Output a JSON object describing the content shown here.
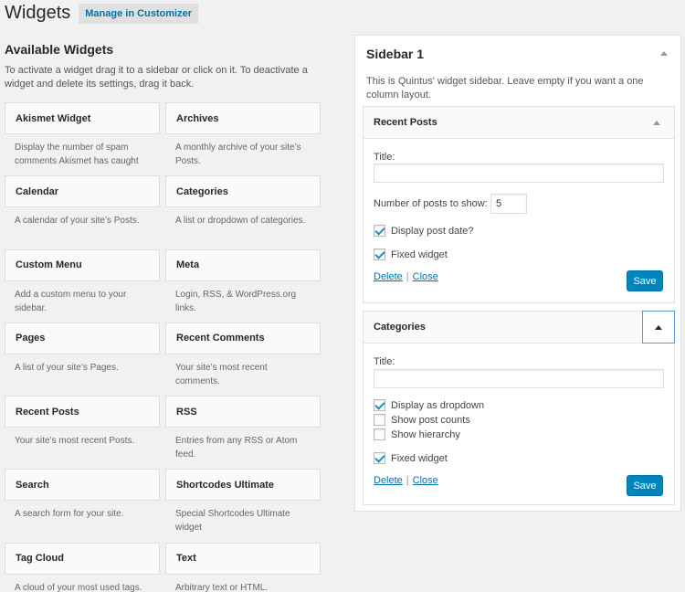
{
  "header": {
    "title": "Widgets",
    "customizer_button": "Manage in Customizer"
  },
  "available": {
    "title": "Available Widgets",
    "description": "To activate a widget drag it to a sidebar or click on it. To deactivate a widget and delete its settings, drag it back.",
    "widgets": [
      {
        "title": "Akismet Widget",
        "desc": "Display the number of spam comments Akismet has caught"
      },
      {
        "title": "Archives",
        "desc": "A monthly archive of your site’s Posts."
      },
      {
        "title": "Calendar",
        "desc": "A calendar of your site’s Posts."
      },
      {
        "title": "Categories",
        "desc": "A list or dropdown of categories."
      },
      {
        "title": "Custom Menu",
        "desc": "Add a custom menu to your sidebar."
      },
      {
        "title": "Meta",
        "desc": "Login, RSS, & WordPress.org links."
      },
      {
        "title": "Pages",
        "desc": "A list of your site’s Pages."
      },
      {
        "title": "Recent Comments",
        "desc": "Your site’s most recent comments."
      },
      {
        "title": "Recent Posts",
        "desc": "Your site’s most recent Posts."
      },
      {
        "title": "RSS",
        "desc": "Entries from any RSS or Atom feed."
      },
      {
        "title": "Search",
        "desc": "A search form for your site."
      },
      {
        "title": "Shortcodes Ultimate",
        "desc": "Special Shortcodes Ultimate widget"
      },
      {
        "title": "Tag Cloud",
        "desc": "A cloud of your most used tags."
      },
      {
        "title": "Text",
        "desc": "Arbitrary text or HTML."
      }
    ]
  },
  "sidebar": {
    "title": "Sidebar 1",
    "description": "This is Quintus' widget sidebar. Leave empty if you want a one column layout.",
    "recent_posts": {
      "title": "Recent Posts",
      "title_label": "Title:",
      "title_value": "",
      "number_label": "Number of posts to show:",
      "number_value": "5",
      "display_date_label": "Display post date?",
      "display_date_checked": true,
      "fixed_label": "Fixed widget",
      "fixed_checked": true,
      "delete_label": "Delete",
      "separator": "|",
      "close_label": "Close",
      "save_label": "Save"
    },
    "categories": {
      "title": "Categories",
      "title_label": "Title:",
      "title_value": "",
      "dropdown_label": "Display as dropdown",
      "dropdown_checked": true,
      "counts_label": "Show post counts",
      "counts_checked": false,
      "hierarchy_label": "Show hierarchy",
      "hierarchy_checked": false,
      "fixed_label": "Fixed widget",
      "fixed_checked": true,
      "delete_label": "Delete",
      "separator": "|",
      "close_label": "Close",
      "save_label": "Save"
    }
  },
  "icons": {
    "collapse": "arrow-up-icon",
    "checkmark": "checkmark-icon"
  },
  "colors": {
    "accent": "#0085ba",
    "link": "#0073aa",
    "background": "#f1f1f1"
  }
}
